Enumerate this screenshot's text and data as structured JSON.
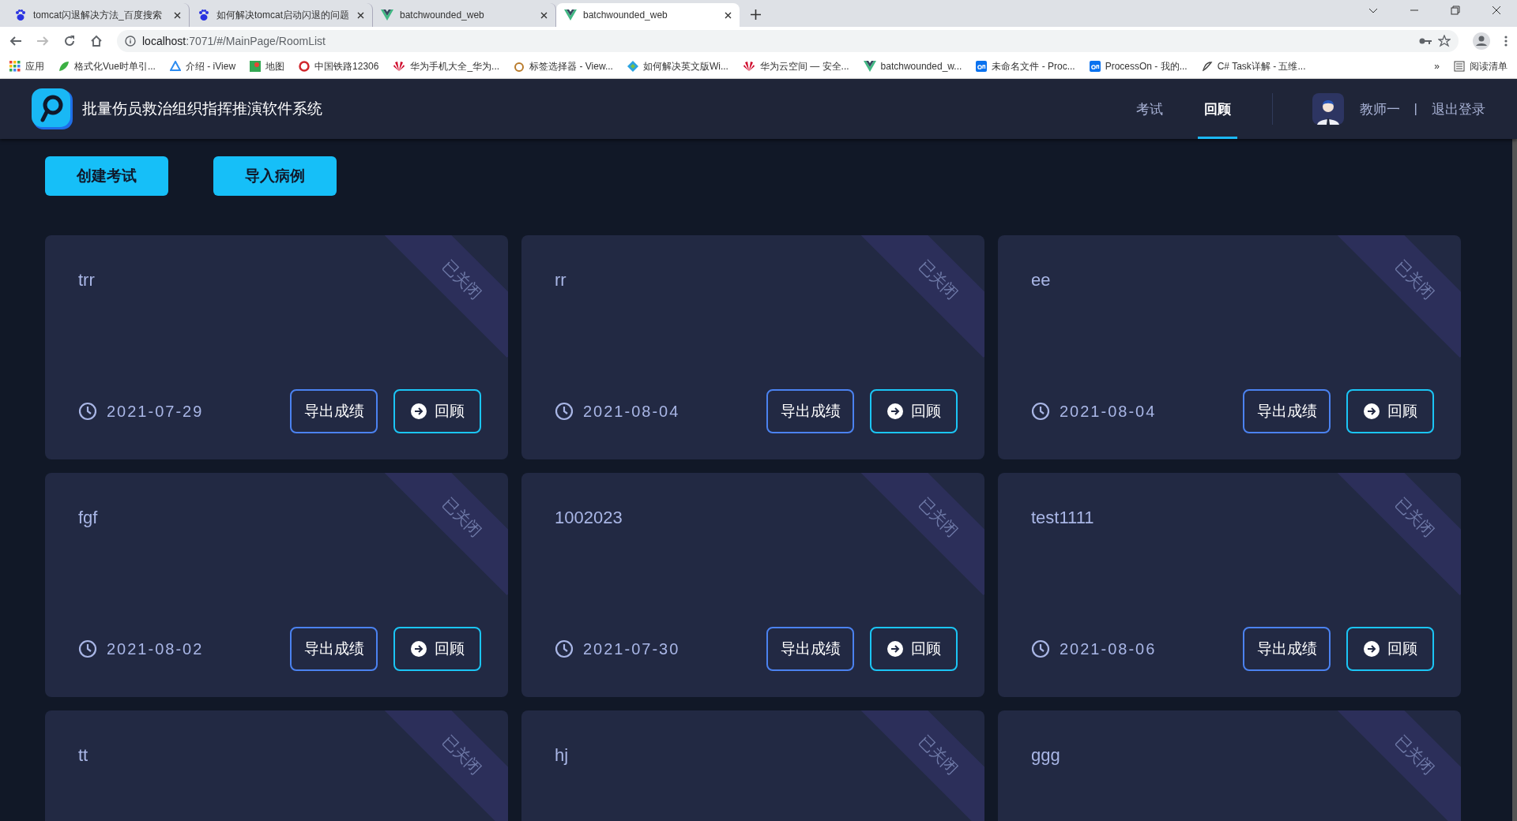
{
  "browser": {
    "tabs": [
      {
        "title": "tomcat闪退解决方法_百度搜索",
        "kind": "baidu",
        "selected": false
      },
      {
        "title": "如何解决tomcat启动闪退的问题",
        "kind": "baidu",
        "selected": false
      },
      {
        "title": "batchwounded_web",
        "kind": "vue",
        "selected": false
      },
      {
        "title": "batchwounded_web",
        "kind": "vue",
        "selected": true
      }
    ],
    "url_host": "localhost",
    "url_rest": ":7071/#/MainPage/RoomList",
    "bookmarks": [
      {
        "label": "应用",
        "kind": "apps"
      },
      {
        "label": "格式化Vue时单引...",
        "kind": "leaf"
      },
      {
        "label": "介绍 - iView",
        "kind": "iview"
      },
      {
        "label": "地图",
        "kind": "maps"
      },
      {
        "label": "中国铁路12306",
        "kind": "railway"
      },
      {
        "label": "华为手机大全_华为...",
        "kind": "huawei"
      },
      {
        "label": "标签选择器 - View...",
        "kind": "ring"
      },
      {
        "label": "如何解决英文版Wi...",
        "kind": "diamond"
      },
      {
        "label": "华为云空间 — 安全...",
        "kind": "huawei"
      },
      {
        "label": "batchwounded_w...",
        "kind": "vue"
      },
      {
        "label": "未命名文件 - Proc...",
        "kind": "on"
      },
      {
        "label": "ProcessOn - 我的...",
        "kind": "on"
      },
      {
        "label": "C# Task详解 - 五维...",
        "kind": "pen"
      }
    ],
    "more": "»",
    "reading_list": "阅读清单"
  },
  "app": {
    "title": "批量伤员救治组织指挥推演软件系统",
    "nav": [
      {
        "label": "考试",
        "selected": false
      },
      {
        "label": "回顾",
        "selected": true
      }
    ],
    "user": "教师一",
    "separator": "|",
    "logout": "退出登录"
  },
  "actions": [
    "创建考试",
    "导入病例"
  ],
  "cards": [
    {
      "name": "trr",
      "status": "已关闭",
      "date": "2021-07-29",
      "buttons": [
        "导出成绩",
        "回顾"
      ]
    },
    {
      "name": "rr",
      "status": "已关闭",
      "date": "2021-08-04",
      "buttons": [
        "导出成绩",
        "回顾"
      ]
    },
    {
      "name": "ee",
      "status": "已关闭",
      "date": "2021-08-04",
      "buttons": [
        "导出成绩",
        "回顾"
      ]
    },
    {
      "name": "fgf",
      "status": "已关闭",
      "date": "2021-08-02",
      "buttons": [
        "导出成绩",
        "回顾"
      ]
    },
    {
      "name": "1002023",
      "status": "已关闭",
      "date": "2021-07-30",
      "buttons": [
        "导出成绩",
        "回顾"
      ]
    },
    {
      "name": "test1111",
      "status": "已关闭",
      "date": "2021-08-06",
      "buttons": [
        "导出成绩",
        "回顾"
      ]
    },
    {
      "name": "tt",
      "status": "已关闭"
    },
    {
      "name": "hj",
      "status": "已关闭"
    },
    {
      "name": "ggg",
      "status": "已关闭"
    }
  ]
}
